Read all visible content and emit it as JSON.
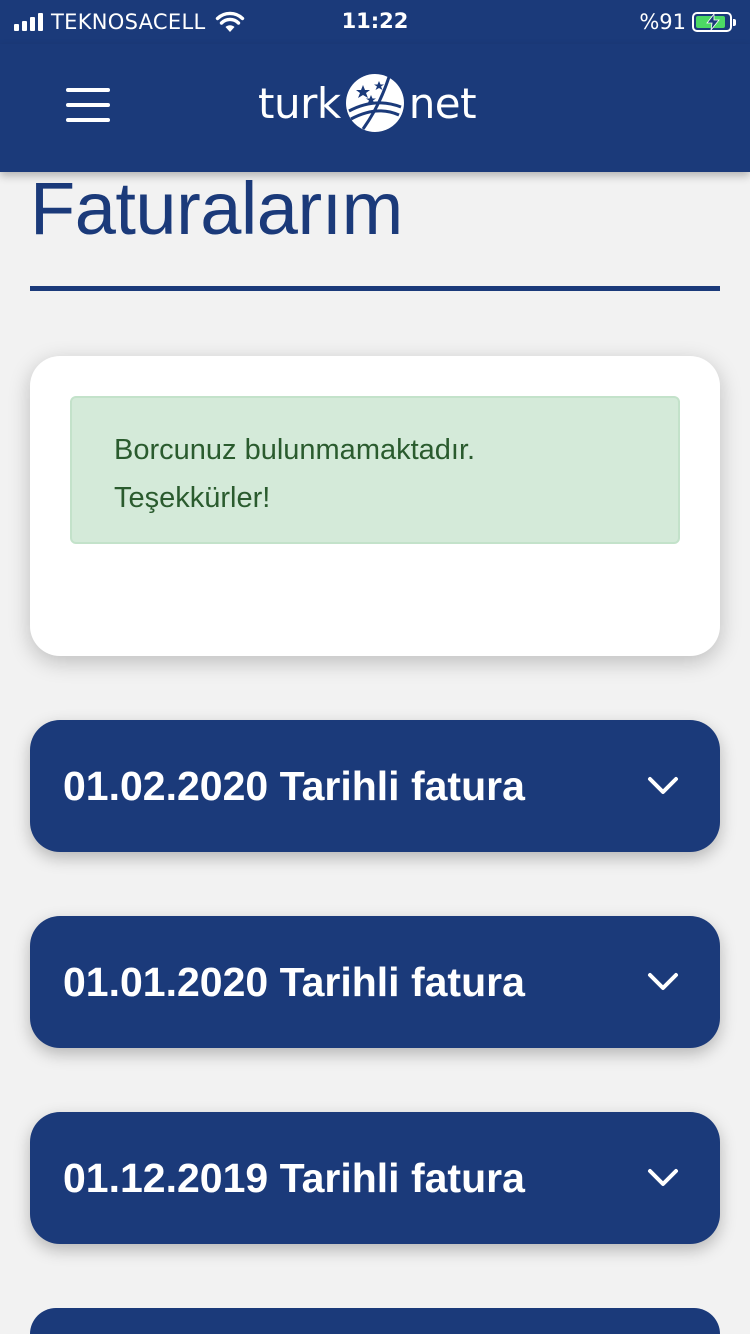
{
  "status_bar": {
    "carrier": "TEKNOSACELL",
    "time": "11:22",
    "battery": "%91",
    "battery_level": 0.91,
    "battery_color": "#4cd964"
  },
  "header": {
    "menu_icon": "hamburger-menu-icon",
    "logo_left": "turk",
    "logo_right": "net",
    "logo_icon": "globe-icon",
    "bg_color": "#1b3a7a"
  },
  "page": {
    "title": "Faturalarım"
  },
  "debt_notice": {
    "line1": "Borcunuz bulunmamaktadır.",
    "line2": "Teşekkürler!"
  },
  "invoices": [
    {
      "label": "01.02.2020 Tarihli fatura",
      "icon": "chevron-down-icon"
    },
    {
      "label": "01.01.2020 Tarihli fatura",
      "icon": "chevron-down-icon"
    },
    {
      "label": "01.12.2019 Tarihli fatura",
      "icon": "chevron-down-icon"
    },
    {
      "label": "",
      "icon": ""
    }
  ]
}
